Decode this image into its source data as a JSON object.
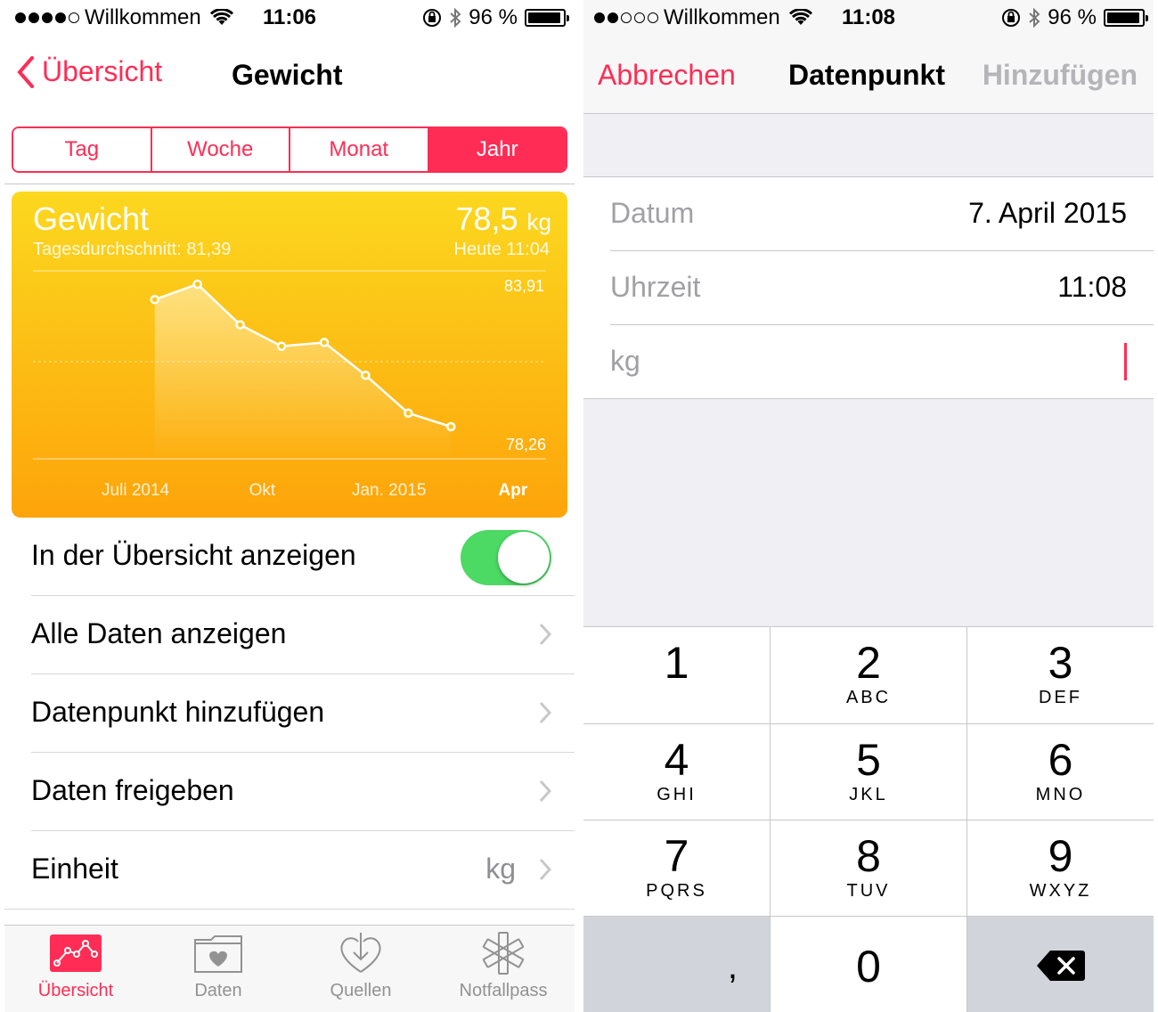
{
  "left": {
    "status": {
      "carrier": "Willkommen",
      "time": "11:06",
      "battery": "96 %",
      "signal_filled": 4,
      "battery_level": 0.96
    },
    "nav": {
      "back_label": "Übersicht",
      "title": "Gewicht"
    },
    "segments": [
      "Tag",
      "Woche",
      "Monat",
      "Jahr"
    ],
    "segment_selected": "Jahr",
    "card": {
      "title": "Gewicht",
      "subtitle": "Tagesdurchschnitt: 81,39",
      "value": "78,5",
      "unit": "kg",
      "when": "Heute 11:04",
      "colors": {
        "top": "#fcd81f",
        "bottom": "#fda40a"
      }
    },
    "chart_data": {
      "type": "line",
      "x": [
        "2014-07-15",
        "2014-08-15",
        "2014-09-15",
        "2014-10-15",
        "2014-11-15",
        "2014-12-15",
        "2015-01-15",
        "2015-02-15",
        "2015-03-15"
      ],
      "y": [
        83.3,
        83.91,
        82.3,
        81.45,
        81.6,
        80.3,
        78.8,
        78.26,
        null
      ],
      "ymax_label": "83,91",
      "ymin_label": "78,26",
      "tick_labels": [
        "Juli 2014",
        "Okt",
        "Jan. 2015",
        "Apr"
      ],
      "tick_dates": [
        "2014-07-01",
        "2014-10-01",
        "2015-01-01",
        "2015-04-01"
      ],
      "xlim": [
        "2014-04-15",
        "2015-04-25"
      ],
      "ylim": [
        78.26,
        83.91
      ],
      "grid": true
    },
    "rows": {
      "show_in_overview": "In der Übersicht anzeigen",
      "show_in_overview_on": true,
      "all_data": "Alle Daten anzeigen",
      "add_datapoint": "Datenpunkt hinzufügen",
      "share_data": "Daten freigeben",
      "unit_label": "Einheit",
      "unit_value": "kg"
    },
    "tabs": [
      {
        "label": "Übersicht",
        "icon": "dashboard-icon",
        "active": true
      },
      {
        "label": "Daten",
        "icon": "folder-heart-icon",
        "active": false
      },
      {
        "label": "Quellen",
        "icon": "download-heart-icon",
        "active": false
      },
      {
        "label": "Notfallpass",
        "icon": "star-of-life-icon",
        "active": false
      }
    ]
  },
  "right": {
    "status": {
      "carrier": "Willkommen",
      "time": "11:08",
      "battery": "96 %",
      "signal_filled": 2,
      "battery_level": 0.96
    },
    "nav": {
      "cancel": "Abbrechen",
      "title": "Datenpunkt",
      "add": "Hinzufügen"
    },
    "form": {
      "date_label": "Datum",
      "date_value": "7. April 2015",
      "time_label": "Uhrzeit",
      "time_value": "11:08",
      "kg_label": "kg",
      "kg_value": ""
    },
    "keypad": [
      {
        "num": "1",
        "letters": ""
      },
      {
        "num": "2",
        "letters": "ABC"
      },
      {
        "num": "3",
        "letters": "DEF"
      },
      {
        "num": "4",
        "letters": "GHI"
      },
      {
        "num": "5",
        "letters": "JKL"
      },
      {
        "num": "6",
        "letters": "MNO"
      },
      {
        "num": "7",
        "letters": "PQRS"
      },
      {
        "num": "8",
        "letters": "TUV"
      },
      {
        "num": "9",
        "letters": "WXYZ"
      },
      {
        "num": ",",
        "letters": ""
      },
      {
        "num": "0",
        "letters": ""
      },
      {
        "num": "",
        "letters": "",
        "icon": "delete-icon"
      }
    ],
    "accent": "#ff2d55"
  }
}
